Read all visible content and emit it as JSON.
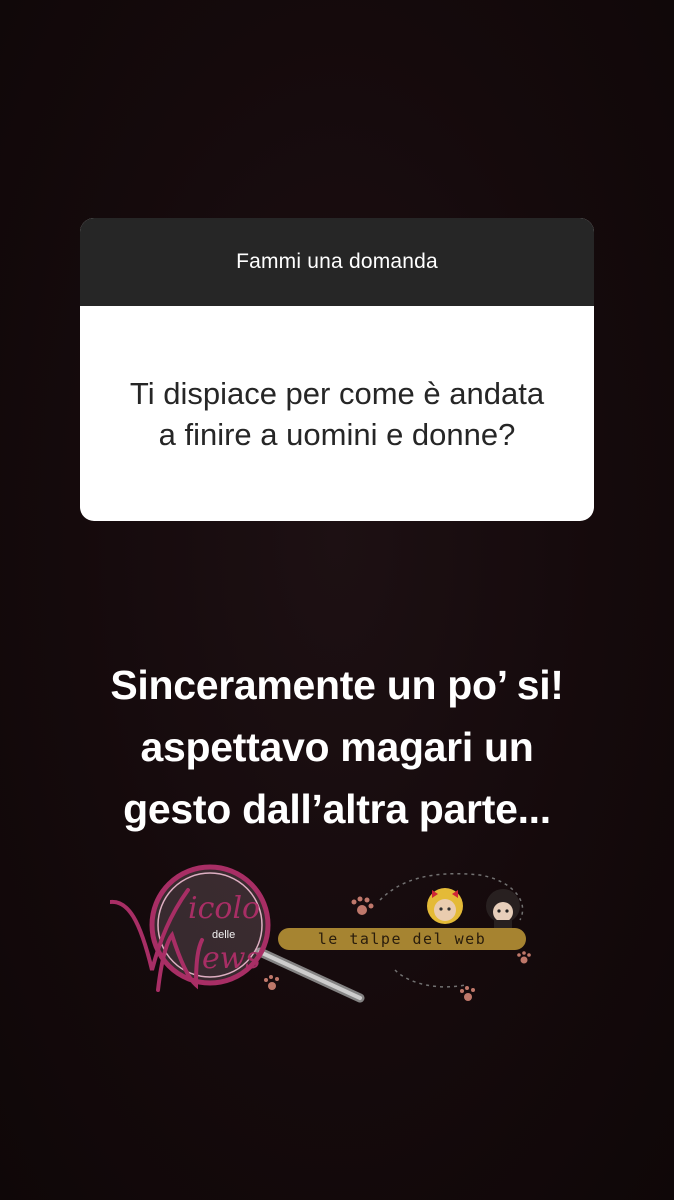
{
  "story": {
    "background_color": "#140b0d"
  },
  "question_sticker": {
    "header": "Fammi una domanda",
    "question": "Ti dispiace per come è andata a finire a uomini e donne?"
  },
  "answer": {
    "lines": [
      "Sinceramente un po’ si!",
      "aspettavo magari un",
      "gesto dall’altra parte..."
    ]
  },
  "watermark": {
    "logo_text": "Vicolo delle News",
    "logo_word_1": "icolo",
    "logo_word_2": "delle",
    "logo_word_3": "ews",
    "caption": "le talpe del web",
    "accent_color": "#b0306a"
  }
}
